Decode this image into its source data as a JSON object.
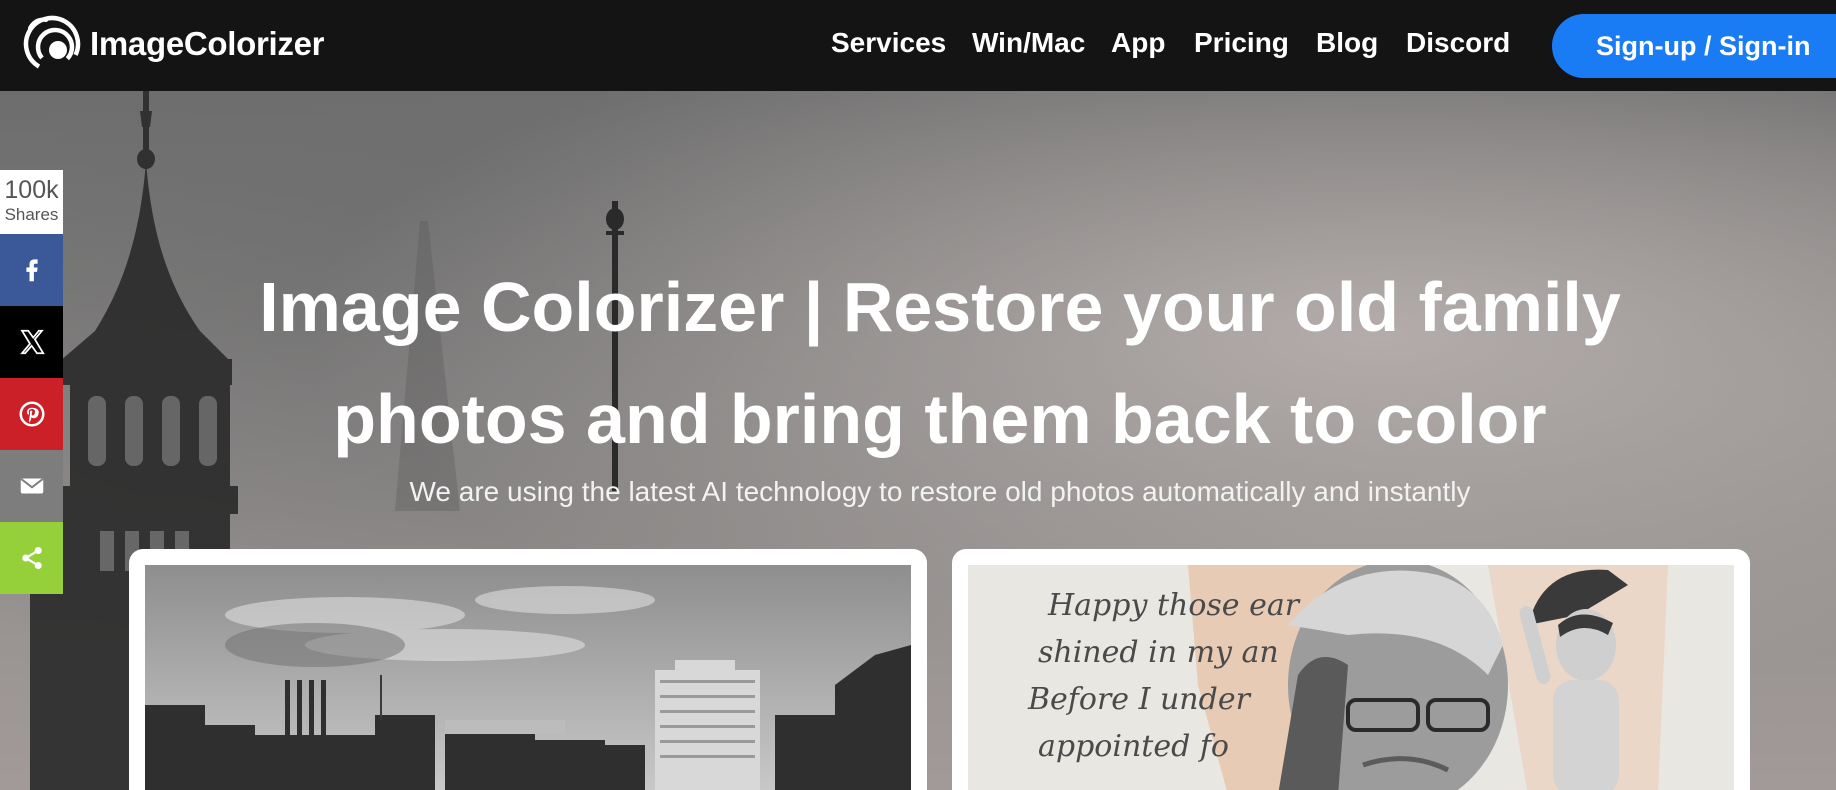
{
  "brand": {
    "name": "ImageColorizer",
    "logo_icon": "swirl-logo-icon"
  },
  "nav": {
    "items": [
      {
        "label": "Services"
      },
      {
        "label": "Win/Mac"
      },
      {
        "label": "App"
      },
      {
        "label": "Pricing"
      },
      {
        "label": "Blog"
      },
      {
        "label": "Discord"
      }
    ],
    "cta_label": "Sign-up / Sign-in"
  },
  "hero": {
    "title_line1": "Image Colorizer | Restore your old family",
    "title_line2": "photos and bring them back to color",
    "subtitle": "We are using the latest AI technology to restore old photos automatically and instantly"
  },
  "share": {
    "count": "100k",
    "count_label": "Shares",
    "buttons": [
      {
        "icon": "facebook-icon",
        "color": "#3b5998"
      },
      {
        "icon": "x-icon",
        "color": "#000000"
      },
      {
        "icon": "pinterest-icon",
        "color": "#cb2027"
      },
      {
        "icon": "email-icon",
        "color": "#7d7d7d"
      },
      {
        "icon": "share-icon",
        "color": "#95d03a"
      }
    ]
  },
  "cards": {
    "right_poem": [
      "Happy those ear",
      "shined in my an",
      "Before I under",
      "appointed fo"
    ]
  },
  "colors": {
    "accent": "#1a7cf5",
    "topbar": "#141414"
  }
}
